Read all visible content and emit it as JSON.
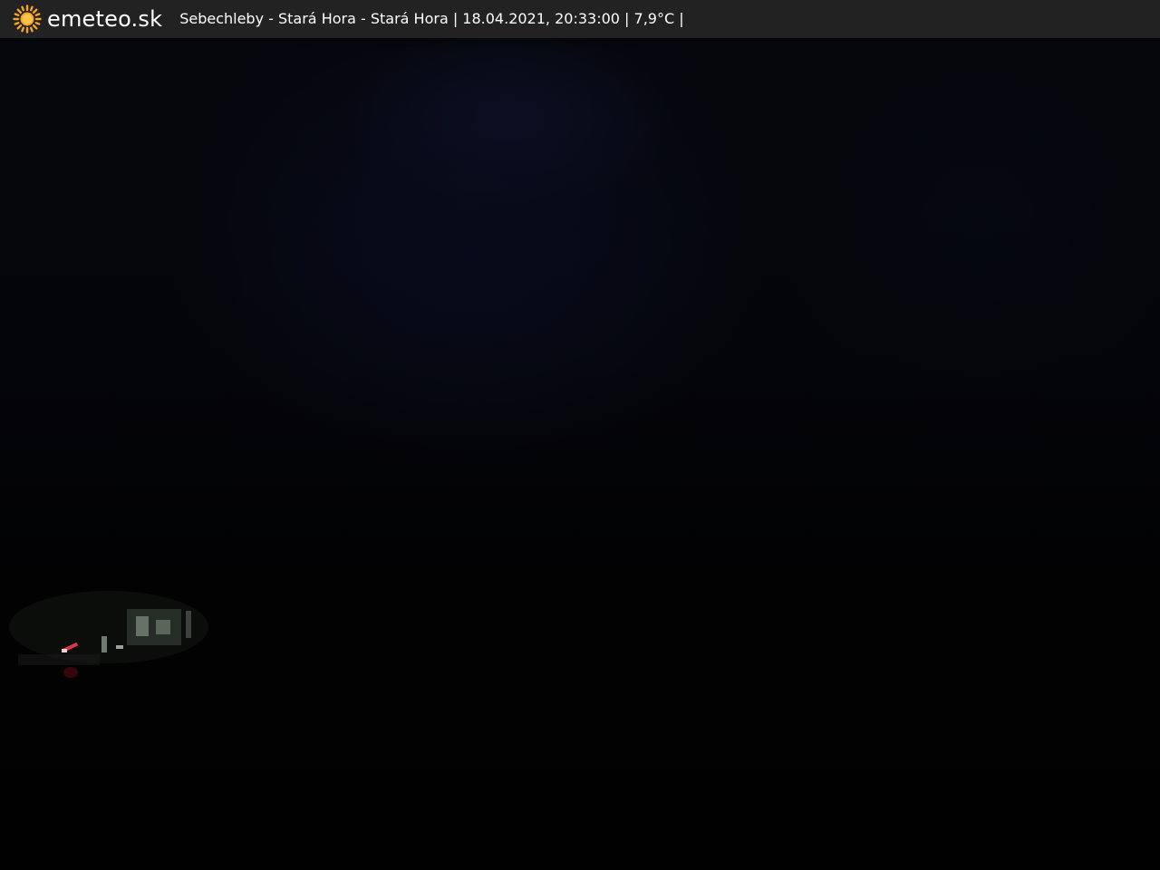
{
  "brand": {
    "name": "emeteo.sk",
    "icon": "sun-icon",
    "icon_color": "#f5a623"
  },
  "caption": {
    "text": "Sebechleby - Stará Hora - Stará Hora | 18.04.2021, 20:33:00 | 7,9°C |"
  },
  "colors": {
    "bar_background": "#222222",
    "text": "#ffffff"
  }
}
